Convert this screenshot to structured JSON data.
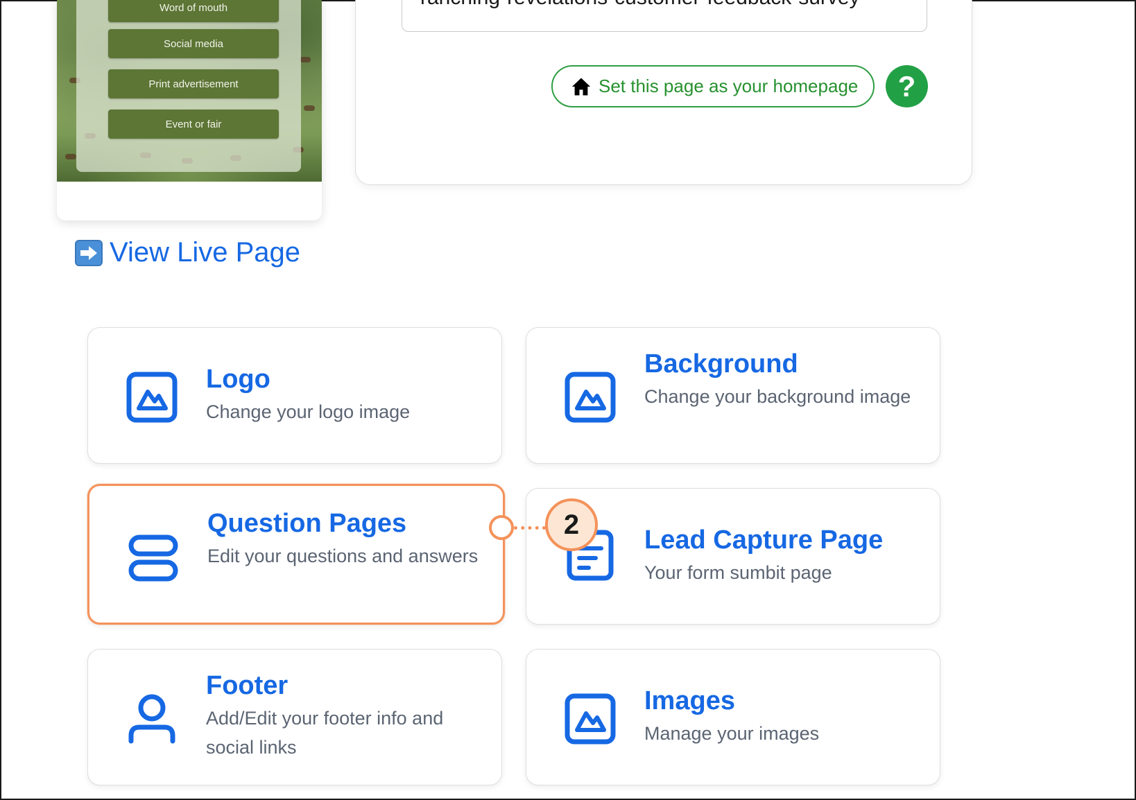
{
  "preview": {
    "options": [
      "Word of mouth",
      "Social media",
      "Print advertisement",
      "Event or fair"
    ]
  },
  "url_card": {
    "slug": "ranching-revelations-customer-feedback-survey",
    "homepage_label": "Set this page as your homepage",
    "help_label": "?"
  },
  "view_live": {
    "label": "View Live Page"
  },
  "cards": {
    "logo": {
      "title": "Logo",
      "desc": "Change your logo image"
    },
    "background": {
      "title": "Background",
      "desc": "Change your background image"
    },
    "question_pages": {
      "title": "Question Pages",
      "desc": "Edit your questions and answers"
    },
    "lead_capture": {
      "title": "Lead Capture Page",
      "desc": "Your form sumbit page"
    },
    "footer": {
      "title": "Footer",
      "desc": "Add/Edit your footer info and social links"
    },
    "images": {
      "title": "Images",
      "desc": "Manage your images"
    }
  },
  "annotation": {
    "step": "2"
  },
  "colors": {
    "accent_blue": "#1668e3",
    "green": "#27912f",
    "highlight_orange": "#f4925a"
  }
}
